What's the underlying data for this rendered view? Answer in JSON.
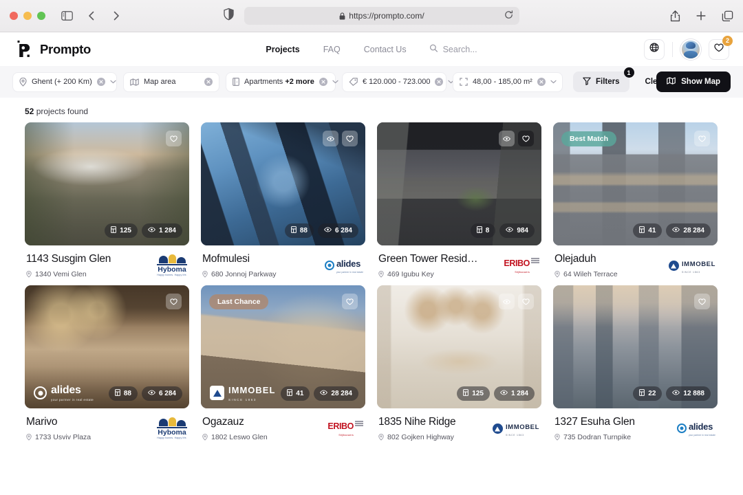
{
  "browser": {
    "url": "https://prompto.com/",
    "icons": {
      "sidebar": "sidebar-toggle-icon",
      "back": "back-arrow-icon",
      "forward": "forward-arrow-icon",
      "shield": "privacy-shield-icon",
      "lock": "lock-icon",
      "reload": "reload-icon",
      "share": "share-icon",
      "new_tab": "plus-icon",
      "tabs": "tab-overview-icon"
    }
  },
  "header": {
    "brand": "Prompto",
    "nav": [
      {
        "label": "Projects",
        "active": true
      },
      {
        "label": "FAQ",
        "active": false
      },
      {
        "label": "Contact Us",
        "active": false
      }
    ],
    "search_label": "Search...",
    "language_icon": "globe-icon",
    "favorites_icon": "heart-icon",
    "favorites_count": "2"
  },
  "filters": {
    "chips": [
      {
        "name": "location",
        "icon": "map-pin-icon",
        "text": "Ghent (+ 200 Km)",
        "clearable": true,
        "caret": true
      },
      {
        "name": "map-area",
        "icon": "map-icon",
        "text": "Map area",
        "clearable": true,
        "caret": false
      },
      {
        "name": "property-type",
        "icon": "building-icon",
        "text": "Apartments ",
        "bold": "+2 more",
        "clearable": true,
        "caret": true
      },
      {
        "name": "price-range",
        "icon": "tag-icon",
        "text": "€ 120.000 - 723.000",
        "clearable": true,
        "caret": true
      },
      {
        "name": "surface-range",
        "icon": "area-icon",
        "text": "48,00 - 185,00 m²",
        "clearable": true,
        "caret": true
      }
    ],
    "filters_label": "Filters",
    "filters_badge": "1",
    "filters_icon": "funnel-icon",
    "clear_all_label": "Clear All",
    "show_map_label": "Show Map",
    "show_map_icon": "map-icon"
  },
  "results": {
    "count": "52",
    "count_suffix": " projects found"
  },
  "cards": [
    {
      "title": "1143 Susgim Glen",
      "address": "1340 Vemi Glen",
      "units": "125",
      "views": "1 284",
      "developer": "Hyboma",
      "developer_logo": "hyboma",
      "badge": null,
      "actions": [
        "heart"
      ],
      "heart_filled": false,
      "watermark": null,
      "image": "exterior-modern-residential-street"
    },
    {
      "title": "Mofmulesi",
      "address": "680 Jonnoj Parkway",
      "units": "88",
      "views": "6 284",
      "developer": "alides",
      "developer_logo": "alides",
      "badge": null,
      "actions": [
        "eye",
        "heart"
      ],
      "heart_filled": false,
      "watermark": null,
      "image": "skyscrapers-looking-up"
    },
    {
      "title": "Green Tower Resid…",
      "address": "469 Igubu Key",
      "units": "8",
      "views": "984",
      "developer": "ERIBO",
      "developer_logo": "eribo",
      "badge": null,
      "actions": [
        "eye",
        "heart"
      ],
      "heart_filled": true,
      "watermark": null,
      "image": "railway-balcony-terrace"
    },
    {
      "title": "Olejaduh",
      "address": "64 Wileh Terrace",
      "units": "41",
      "views": "28 284",
      "developer": "IMMOBEL",
      "developer_logo": "immobel",
      "badge": {
        "label": "Best Match",
        "color": "#5aa79c"
      },
      "actions": [
        "heart"
      ],
      "heart_filled": false,
      "watermark": null,
      "image": "modern-grey-apartment-block"
    },
    {
      "title": "Marivo",
      "address": "1733 Usviv Plaza",
      "units": "88",
      "views": "6 284",
      "developer": "Hyboma",
      "developer_logo": "hyboma",
      "badge": null,
      "actions": [
        "heart"
      ],
      "heart_filled": false,
      "watermark": "alides",
      "image": "warm-wooden-kitchen-interior"
    },
    {
      "title": "Ogazauz",
      "address": "1802 Leswo Glen",
      "units": "41",
      "views": "28 284",
      "developer": "ERIBO",
      "developer_logo": "eribo",
      "badge": {
        "label": "Last Chance",
        "color": "#c08e6e"
      },
      "actions": [
        "heart"
      ],
      "heart_filled": false,
      "watermark": "immobel",
      "image": "evening-apartment-building-exterior"
    },
    {
      "title": "1835 Nihe Ridge",
      "address": "802 Gojken Highway",
      "units": "125",
      "views": "1 284",
      "developer": "IMMOBEL",
      "developer_logo": "immobel",
      "badge": null,
      "actions": [
        "eye",
        "heart"
      ],
      "heart_filled": false,
      "watermark": null,
      "image": "bright-dining-room-interior"
    },
    {
      "title": "1327 Esuha Glen",
      "address": "735 Dodran Turnpike",
      "units": "22",
      "views": "12 888",
      "developer": "alides",
      "developer_logo": "alides",
      "badge": null,
      "actions": [
        "heart"
      ],
      "heart_filled": false,
      "watermark": null,
      "image": "aerial-city-skyline"
    }
  ],
  "icon_names": {
    "units": "floorplan-icon",
    "views": "eye-icon",
    "pin": "map-pin-icon"
  }
}
